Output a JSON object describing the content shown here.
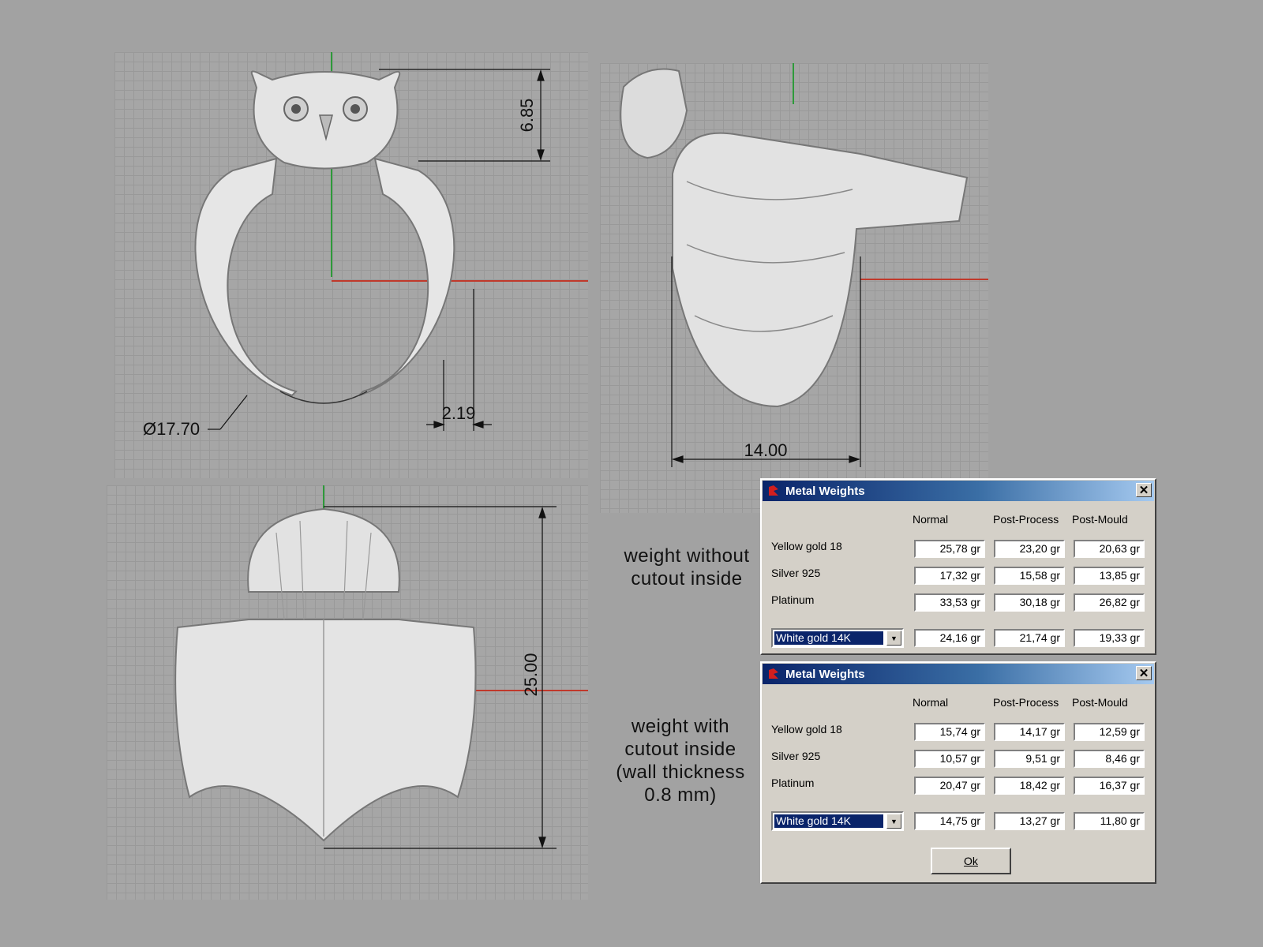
{
  "dimensions": {
    "top_height": "6.85",
    "diameter": "Ø17.70",
    "band_width": "2.19",
    "side_depth": "14.00",
    "bottom_length": "25.00"
  },
  "notes": {
    "without_cutout": "weight without\ncutout inside",
    "with_cutout": "weight with\ncutout inside\n(wall thickness\n0.8 mm)"
  },
  "dialog_top": {
    "title": "Metal Weights",
    "columns": [
      "Normal",
      "Post-Process",
      "Post-Mould"
    ],
    "rows": [
      {
        "label": "Yellow gold 18",
        "values": [
          "25,78 gr",
          "23,20 gr",
          "20,63 gr"
        ]
      },
      {
        "label": "Silver 925",
        "values": [
          "17,32 gr",
          "15,58 gr",
          "13,85 gr"
        ]
      },
      {
        "label": "Platinum",
        "values": [
          "33,53 gr",
          "30,18 gr",
          "26,82 gr"
        ]
      }
    ],
    "select": {
      "value": "White gold 14K",
      "values": [
        "24,16 gr",
        "21,74 gr",
        "19,33 gr"
      ]
    }
  },
  "dialog_bottom": {
    "title": "Metal Weights",
    "columns": [
      "Normal",
      "Post-Process",
      "Post-Mould"
    ],
    "rows": [
      {
        "label": "Yellow gold 18",
        "values": [
          "15,74 gr",
          "14,17 gr",
          "12,59 gr"
        ]
      },
      {
        "label": "Silver 925",
        "values": [
          "10,57 gr",
          "9,51 gr",
          "8,46 gr"
        ]
      },
      {
        "label": "Platinum",
        "values": [
          "20,47 gr",
          "18,42 gr",
          "16,37 gr"
        ]
      }
    ],
    "select": {
      "value": "White gold 14K",
      "values": [
        "14,75 gr",
        "13,27 gr",
        "11,80 gr"
      ]
    },
    "ok_label": "Ok"
  },
  "colors": {
    "x_axis": "#c0392b",
    "y_axis": "#2e9a3a",
    "title_start": "#0a246a",
    "title_end": "#a6caf0"
  }
}
